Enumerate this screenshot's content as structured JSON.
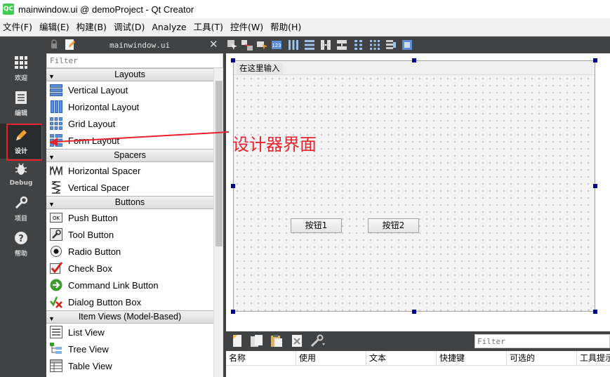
{
  "window": {
    "logo": "QC",
    "title": "mainwindow.ui @ demoProject - Qt Creator"
  },
  "menu": [
    "文件(F)",
    "编辑(E)",
    "构建(B)",
    "调试(D)",
    "Analyze",
    "工具(T)",
    "控件(W)",
    "帮助(H)"
  ],
  "modes": [
    {
      "label": "欢迎",
      "icon": "grid-icon"
    },
    {
      "label": "编辑",
      "icon": "document-icon"
    },
    {
      "label": "设计",
      "icon": "pencil-icon",
      "active": true
    },
    {
      "label": "Debug",
      "icon": "bug-icon"
    },
    {
      "label": "项目",
      "icon": "wrench-icon"
    },
    {
      "label": "帮助",
      "icon": "help-icon"
    }
  ],
  "widgetbox": {
    "file": "mainwindow.ui",
    "filter_placeholder": "Filter",
    "categories": [
      {
        "name": "Layouts",
        "items": [
          "Vertical Layout",
          "Horizontal Layout",
          "Grid Layout",
          "Form Layout"
        ]
      },
      {
        "name": "Spacers",
        "items": [
          "Horizontal Spacer",
          "Vertical Spacer"
        ]
      },
      {
        "name": "Buttons",
        "items": [
          "Push Button",
          "Tool Button",
          "Radio Button",
          "Check Box",
          "Command Link Button",
          "Dialog Button Box"
        ]
      },
      {
        "name": "Item Views (Model-Based)",
        "items": [
          "List View",
          "Tree View",
          "Table View"
        ]
      }
    ]
  },
  "form": {
    "menu_placeholder": "在这里输入",
    "button1": "按钮1",
    "button2": "按钮2"
  },
  "annotation": {
    "text": "设计器界面",
    "color": "#e8212b"
  },
  "action_editor": {
    "filter_placeholder": "Filter",
    "columns": [
      "名称",
      "使用",
      "文本",
      "快捷键",
      "可选的",
      "工具提示"
    ]
  },
  "colors": {
    "sidebar": "#404244",
    "handle": "#00008b",
    "accent_red": "#e8212b"
  }
}
